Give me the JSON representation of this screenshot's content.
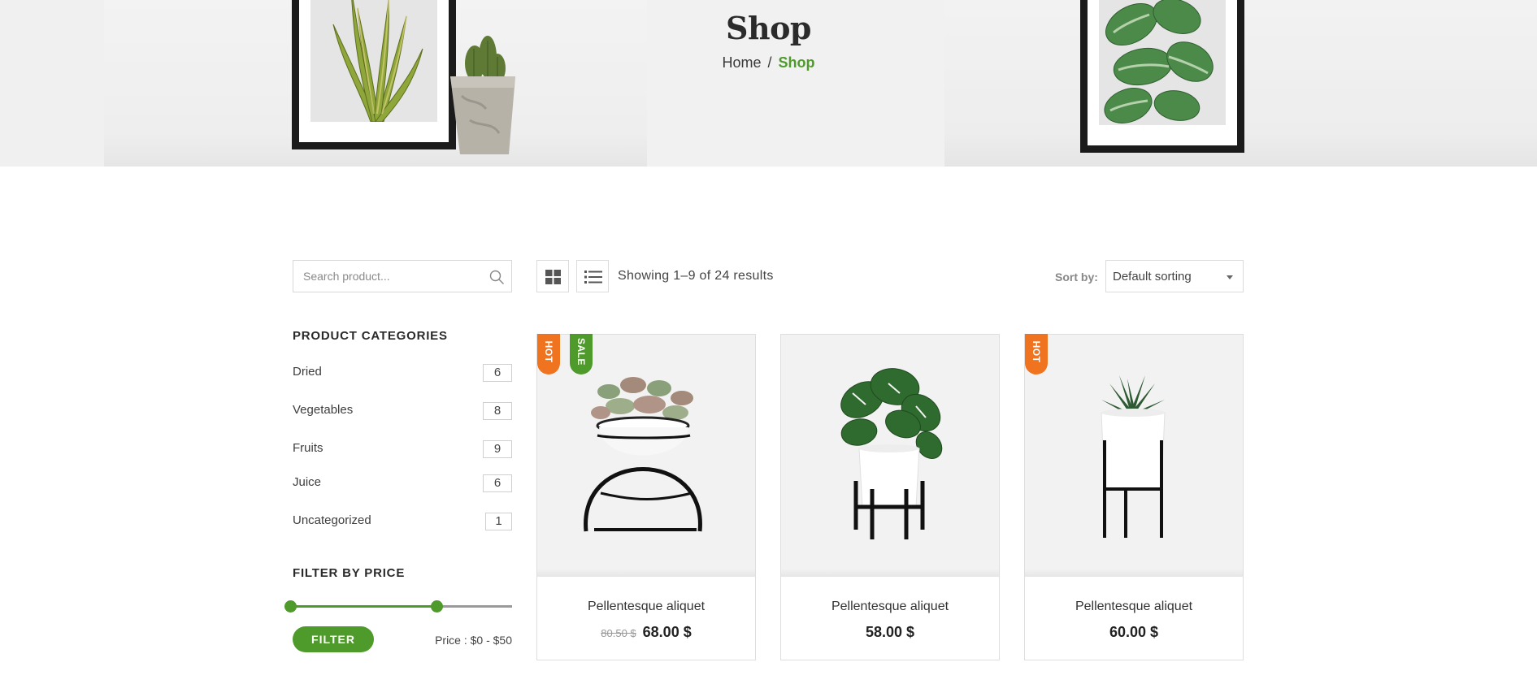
{
  "hero": {
    "title": "Shop",
    "breadcrumb": {
      "home": "Home",
      "separator": "/",
      "current": "Shop"
    }
  },
  "sidebar": {
    "search": {
      "placeholder": "Search product...",
      "value": ""
    },
    "categories_heading": "PRODUCT CATEGORIES",
    "categories": [
      {
        "name": "Dried",
        "count": "6"
      },
      {
        "name": "Vegetables",
        "count": "8"
      },
      {
        "name": "Fruits",
        "count": "9"
      },
      {
        "name": "Juice",
        "count": "6"
      },
      {
        "name": "Uncategorized",
        "count": "1"
      }
    ],
    "price_filter": {
      "heading": "FILTER BY PRICE",
      "button_label": "FILTER",
      "range_label": "Price : $0 - $50"
    }
  },
  "toolbar": {
    "results_text": "Showing 1–9 of 24 results",
    "sort_label": "Sort by:",
    "sort_value": "Default sorting"
  },
  "products": [
    {
      "name": "Pellentesque aliquet",
      "old_price": "80.50 $",
      "price": "68.00 $",
      "badges": [
        "HOT",
        "SALE"
      ]
    },
    {
      "name": "Pellentesque aliquet",
      "old_price": "",
      "price": "58.00 $",
      "badges": []
    },
    {
      "name": "Pellentesque aliquet",
      "old_price": "",
      "price": "60.00 $",
      "badges": [
        "HOT"
      ]
    }
  ],
  "colors": {
    "accent_green": "#4e9a2a",
    "hot_orange": "#f0731f"
  },
  "icons": {
    "search": "search-icon",
    "grid_view": "grid-view-icon",
    "list_view": "list-view-icon",
    "sort_caret": "caret-down-icon"
  }
}
